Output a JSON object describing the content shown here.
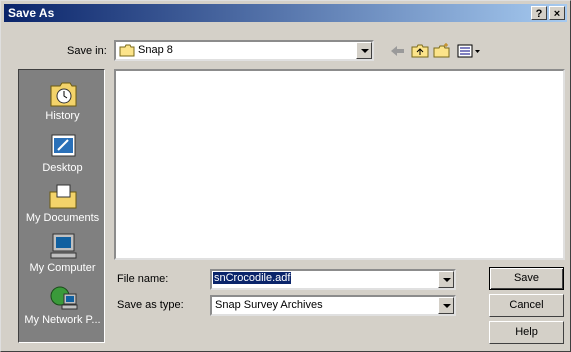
{
  "window": {
    "title": "Save As"
  },
  "titlebar_buttons": {
    "help": "?",
    "close": "×"
  },
  "save_in": {
    "label": "Save in:",
    "value": "Snap 8"
  },
  "places": [
    {
      "label": "History",
      "icon": "history-icon"
    },
    {
      "label": "Desktop",
      "icon": "desktop-icon"
    },
    {
      "label": "My Documents",
      "icon": "my-documents-icon"
    },
    {
      "label": "My Computer",
      "icon": "my-computer-icon"
    },
    {
      "label": "My Network P...",
      "icon": "my-network-places-icon"
    }
  ],
  "file_name": {
    "label": "File name:",
    "value": "snCrocodile.adf"
  },
  "save_as_type": {
    "label": "Save as type:",
    "value": "Snap Survey Archives"
  },
  "buttons": {
    "save": "Save",
    "cancel": "Cancel",
    "help": "Help"
  },
  "colors": {
    "titlebar_start": "#0a246a",
    "titlebar_end": "#a6caf0",
    "selection": "#0a246a"
  }
}
